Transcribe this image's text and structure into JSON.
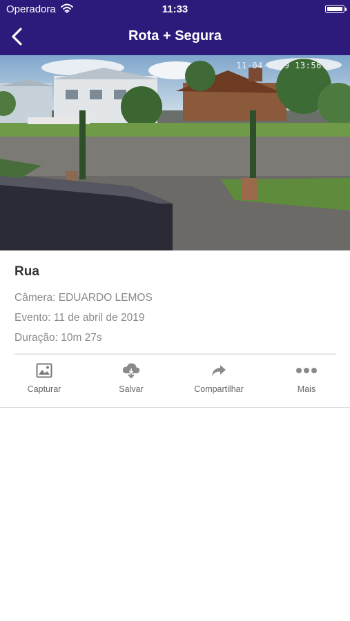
{
  "status_bar": {
    "carrier": "Operadora",
    "time": "11:33"
  },
  "header": {
    "title": "Rota + Segura",
    "back_icon": "chevron-left-icon"
  },
  "video": {
    "timestamp": "11-04-2019 13:56:45"
  },
  "event": {
    "name": "Rua",
    "camera": "Câmera: EDUARDO LEMOS",
    "date": "Evento: 11 de abril de 2019",
    "duration": "Duração: 10m 27s"
  },
  "actions": [
    {
      "label": "Capturar",
      "icon": "image-icon"
    },
    {
      "label": "Salvar",
      "icon": "cloud-download-icon"
    },
    {
      "label": "Compartilhar",
      "icon": "share-arrow-icon"
    },
    {
      "label": "Mais",
      "icon": "more-dots-icon"
    }
  ],
  "colors": {
    "header_bg": "#2e1a7a",
    "text_dark": "#333333",
    "text_muted": "#8a8a8a"
  }
}
